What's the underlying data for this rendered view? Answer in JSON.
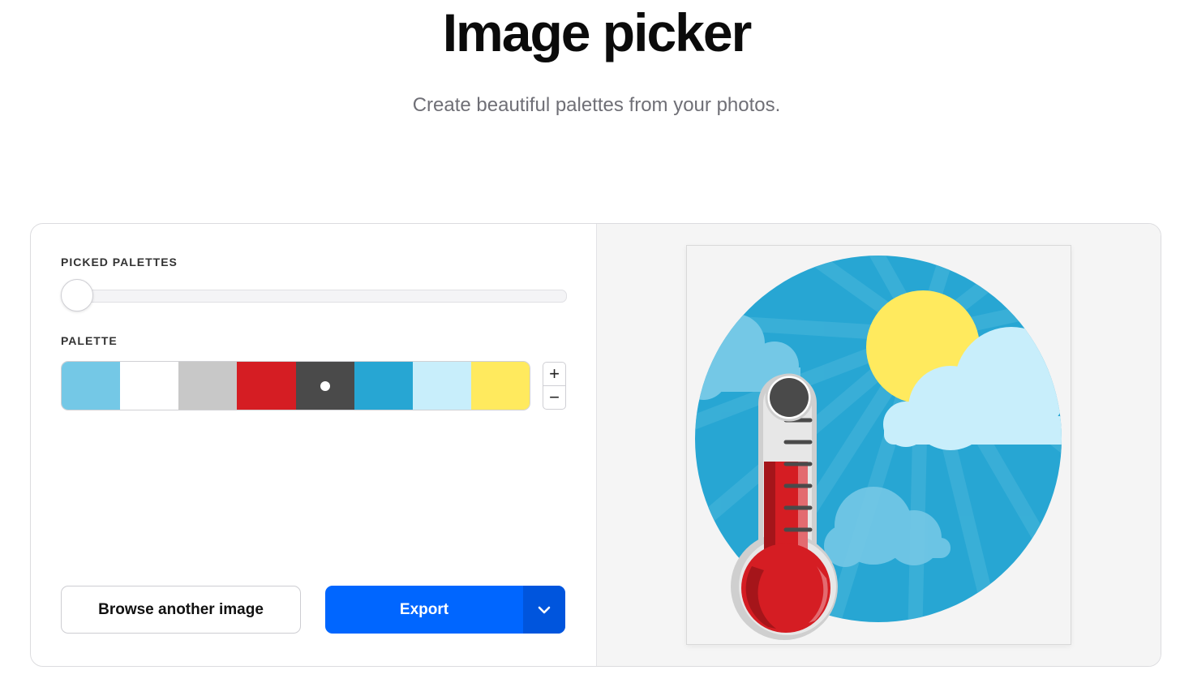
{
  "header": {
    "title": "Image picker",
    "subtitle": "Create beautiful palettes from your photos."
  },
  "controls": {
    "picked_palettes_label": "PICKED PALETTES",
    "palette_label": "PALETTE",
    "slider_value": 0,
    "add_color_symbol": "+",
    "remove_color_symbol": "−"
  },
  "palette": {
    "colors": [
      "#74c8e6",
      "#ffffff",
      "#c8c8c8",
      "#d51d23",
      "#4a4a4a",
      "#27a6d3",
      "#c8eefb",
      "#ffea5e"
    ],
    "selected_index": 4
  },
  "actions": {
    "browse_label": "Browse another image",
    "export_label": "Export",
    "export_menu_icon": "chevron-down-icon"
  },
  "image": {
    "description_icon": "thermometer-sun-clouds-illustration"
  }
}
